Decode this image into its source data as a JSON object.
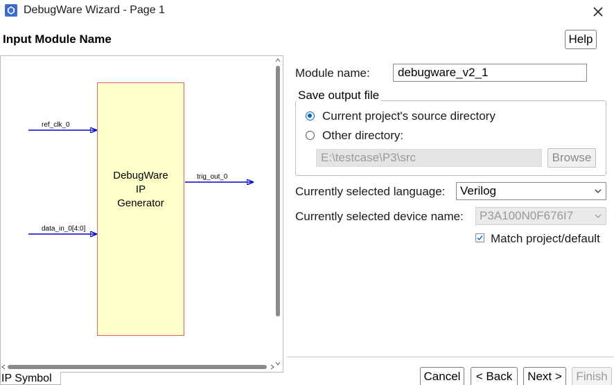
{
  "window": {
    "title": "DebugWare Wizard - Page 1",
    "app_icon": "debugware-app-icon",
    "close_icon": "close-icon"
  },
  "header": {
    "heading": "Input Module Name",
    "help_label": "Help"
  },
  "symbol": {
    "block_label": "DebugWare\nIP\nGenerator",
    "block_fill": "#ffffcc",
    "block_border": "#e06060",
    "arrow_color": "#0000cc",
    "ports": {
      "ref_clk": "ref_clk_0",
      "data_in": "data_in_0[4:0]",
      "trig_out": "trig_out_0"
    },
    "tab_label": "IP Symbol"
  },
  "form": {
    "module_name_label": "Module name:",
    "module_name_value": "debugware_v2_1",
    "save_output": {
      "title": "Save output file",
      "option_current": "Current project's source directory",
      "option_other": "Other directory:",
      "selected": "current",
      "directory_value": "E:\\testcase\\P3\\src",
      "browse_label": "Browse"
    },
    "language_label": "Currently selected language:",
    "language_value": "Verilog",
    "device_label": "Currently selected device name:",
    "device_value": "P3A100N0F676I7",
    "match_label": "Match project/default",
    "match_checked": true
  },
  "footer": {
    "cancel_label": "Cancel",
    "back_label": "< Back",
    "next_label": "Next >",
    "finish_label": "Finish"
  },
  "colors": {
    "accent": "#0067c0"
  }
}
